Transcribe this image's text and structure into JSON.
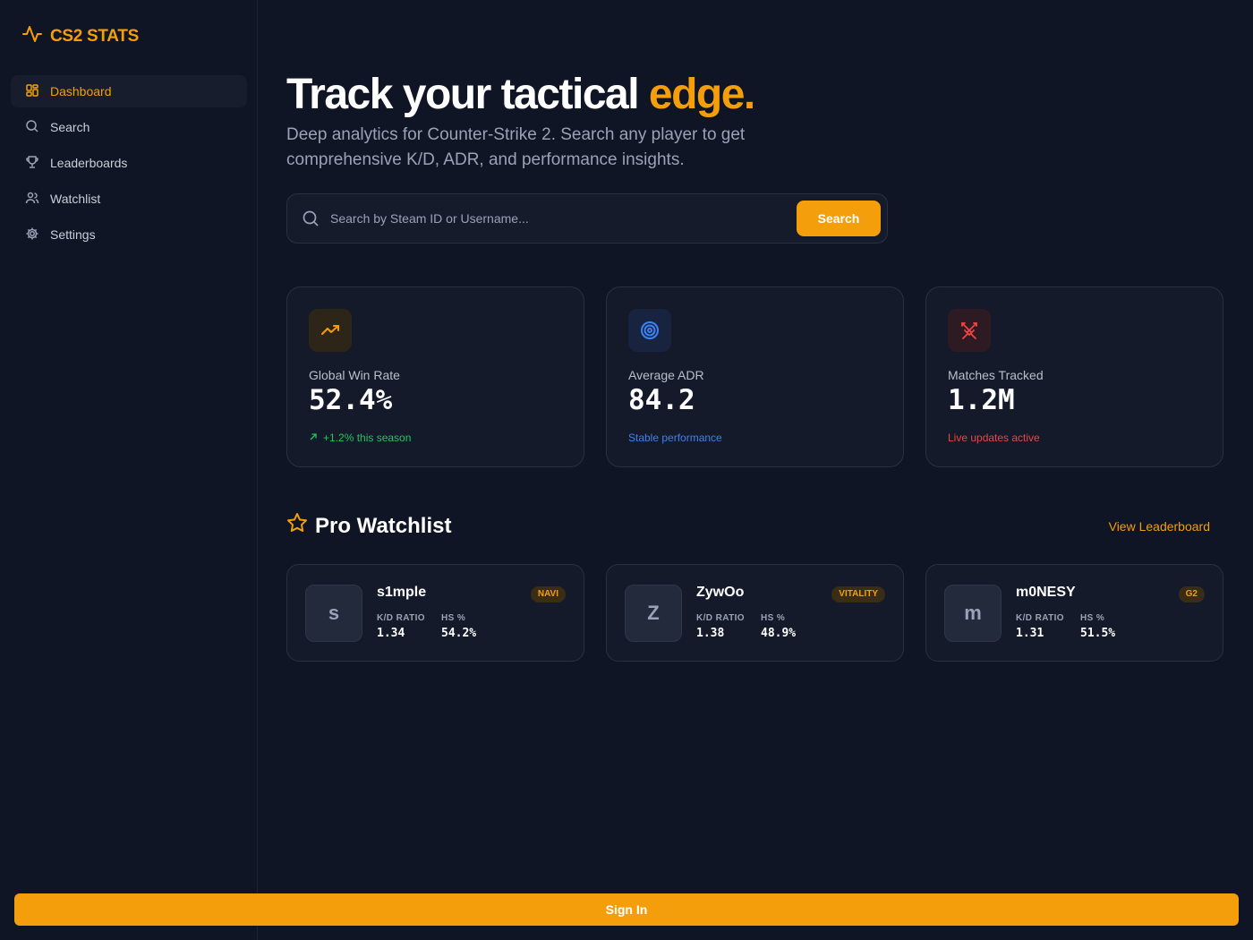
{
  "app": {
    "name": "CS2 STATS"
  },
  "sidebar": {
    "items": [
      {
        "label": "Dashboard",
        "icon": "dashboard-icon",
        "active": true
      },
      {
        "label": "Search",
        "icon": "search-icon"
      },
      {
        "label": "Leaderboards",
        "icon": "trophy-icon"
      },
      {
        "label": "Watchlist",
        "icon": "users-icon"
      },
      {
        "label": "Settings",
        "icon": "gear-icon"
      }
    ]
  },
  "hero": {
    "title_main": "Track your tactical ",
    "title_accent": "edge.",
    "subtitle": "Deep analytics for Counter-Strike 2. Search any player to get comprehensive K/D, ADR, and performance insights."
  },
  "search": {
    "placeholder": "Search by Steam ID or Username...",
    "button": "Search"
  },
  "stats": [
    {
      "label": "Global Win Rate",
      "value": "52.4%",
      "note": "+1.2% this season",
      "icon": "trending-up-icon",
      "note_color": "#22c55e"
    },
    {
      "label": "Average ADR",
      "value": "84.2",
      "note": "Stable performance",
      "icon": "target-icon",
      "note_color": "#3b82f6"
    },
    {
      "label": "Matches Tracked",
      "value": "1.2M",
      "note": "Live updates active",
      "icon": "crossed-swords-icon",
      "note_color": "#ef4444"
    }
  ],
  "watchlist": {
    "title": "Pro Watchlist",
    "link": "View Leaderboard",
    "kd_label": "K/D RATIO",
    "hs_label": "HS %",
    "players": [
      {
        "initial": "s",
        "name": "s1mple",
        "team": "NAVI",
        "kd": "1.34",
        "hs": "54.2%"
      },
      {
        "initial": "Z",
        "name": "ZywOo",
        "team": "VITALITY",
        "kd": "1.38",
        "hs": "48.9%"
      },
      {
        "initial": "m",
        "name": "m0NESY",
        "team": "G2",
        "kd": "1.31",
        "hs": "51.5%"
      }
    ]
  },
  "footer": {
    "signin": "Sign In"
  },
  "colors": {
    "accent": "#f59e0b",
    "background": "#0f1524",
    "card": "#141a29"
  }
}
